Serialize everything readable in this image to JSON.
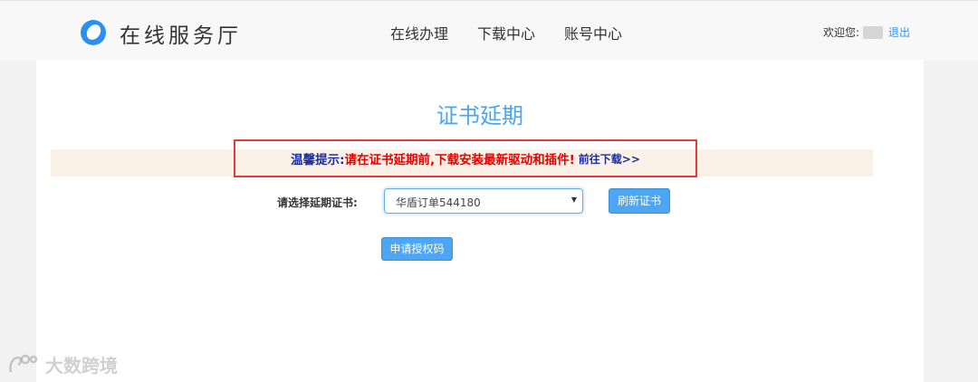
{
  "header": {
    "site_title": "在线服务厅",
    "nav": [
      "在线办理",
      "下载中心",
      "账号中心"
    ],
    "welcome": "欢迎您:",
    "logout": "退出"
  },
  "main": {
    "title": "证书延期",
    "notice": {
      "label": "温馨提示:",
      "text": "请在证书延期前,下载安装最新驱动和插件!",
      "link": "前往下载>>"
    },
    "select_label": "请选择延期证书:",
    "select_value": "华盾订单544180",
    "refresh_button": "刷新证书",
    "apply_button": "申请授权码"
  },
  "watermark": "大数跨境",
  "colors": {
    "accent": "#4da5ea",
    "warning": "#e60000",
    "notice_label": "#1a2e9b",
    "button": "#4ea6f2"
  }
}
